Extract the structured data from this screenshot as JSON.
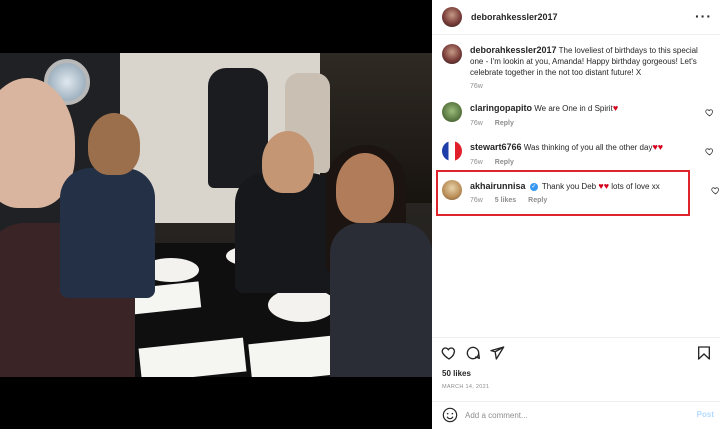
{
  "post": {
    "author": "deborahkessler2017",
    "caption": "The loveliest of birthdays to this special one - I'm lookin at you, Amanda! Happy birthday gorgeous! Let's celebrate together in the not too distant future! X",
    "caption_age": "76w"
  },
  "comments": [
    {
      "username": "claringopapito",
      "text": "We are One in d Spirit",
      "emoji": "♥",
      "age": "76w",
      "reply": "Reply"
    },
    {
      "username": "stewart6766",
      "text": "Was thinking of you all the other day",
      "emoji": "♥♥",
      "age": "76w",
      "reply": "Reply"
    },
    {
      "username": "akhairunnisa",
      "verified": true,
      "text_before": "Thank you Deb",
      "emoji": "♥♥",
      "text_after": "lots of love xx",
      "age": "76w",
      "likes": "5 likes",
      "reply": "Reply"
    }
  ],
  "footer": {
    "likes": "50 likes",
    "date": "MARCH 14, 2021",
    "add_comment_placeholder": "Add a comment...",
    "post_label": "Post"
  },
  "icons": {
    "more": "more-options-icon",
    "like": "heart-icon",
    "comment": "comment-icon",
    "share": "share-icon",
    "save": "bookmark-icon",
    "emoji": "emoji-icon"
  },
  "colors": {
    "highlight_border": "#e0242c",
    "heart_red": "#d6001c",
    "verified_blue": "#3897f0",
    "post_button": "#b3dbff"
  }
}
